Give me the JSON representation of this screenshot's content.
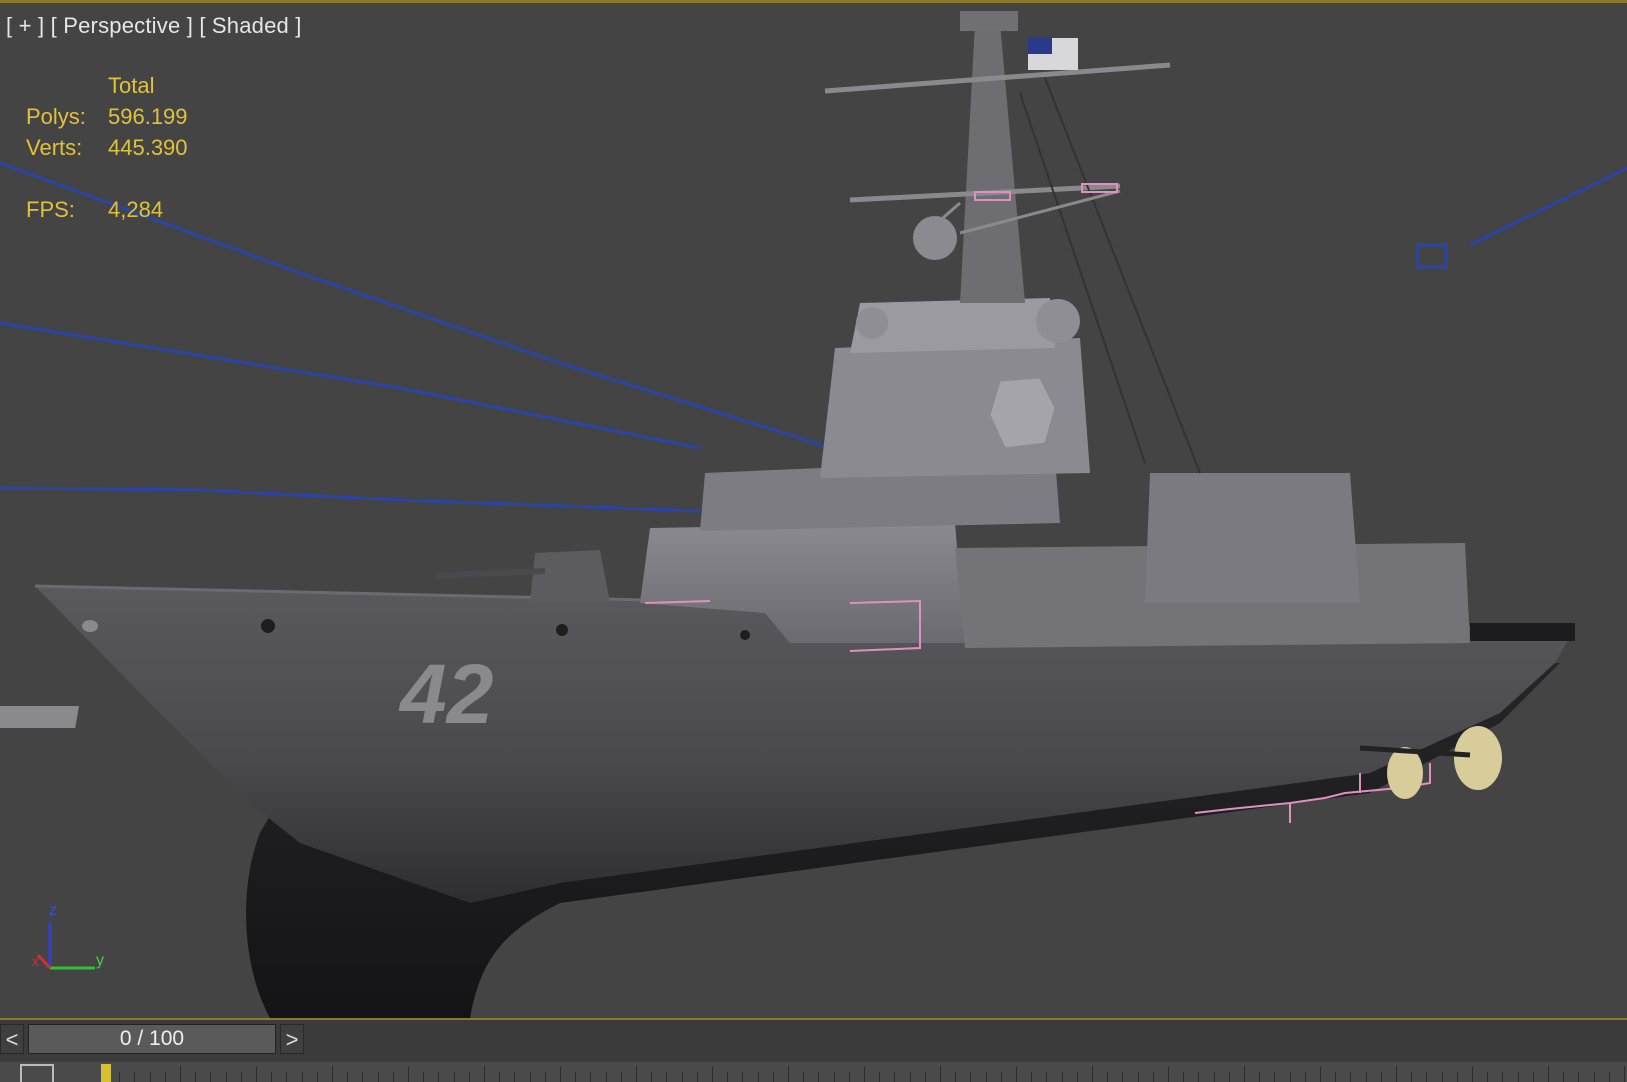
{
  "viewport": {
    "label_parts": [
      "[ + ]",
      "[ Perspective ]",
      "[ Shaded ]"
    ],
    "stats": {
      "header": "Total",
      "polys_label": "Polys:",
      "polys_value": "596.199",
      "verts_label": "Verts:",
      "verts_value": "445.390",
      "fps_label": "FPS:",
      "fps_value": "4,284"
    },
    "hull_number": "42",
    "axis_labels": {
      "z": "z",
      "y": "y",
      "x": "x"
    },
    "colors": {
      "background": "#444444",
      "stats_text": "#e0c23a",
      "selection_line": "#2a44a8",
      "helper_pink": "#e090c0",
      "viewport_border": "#8a7a2a"
    }
  },
  "timeline": {
    "prev_label": "<",
    "next_label": ">",
    "frame_display": "0 / 100",
    "current_frame": 0,
    "total_frames": 100
  }
}
